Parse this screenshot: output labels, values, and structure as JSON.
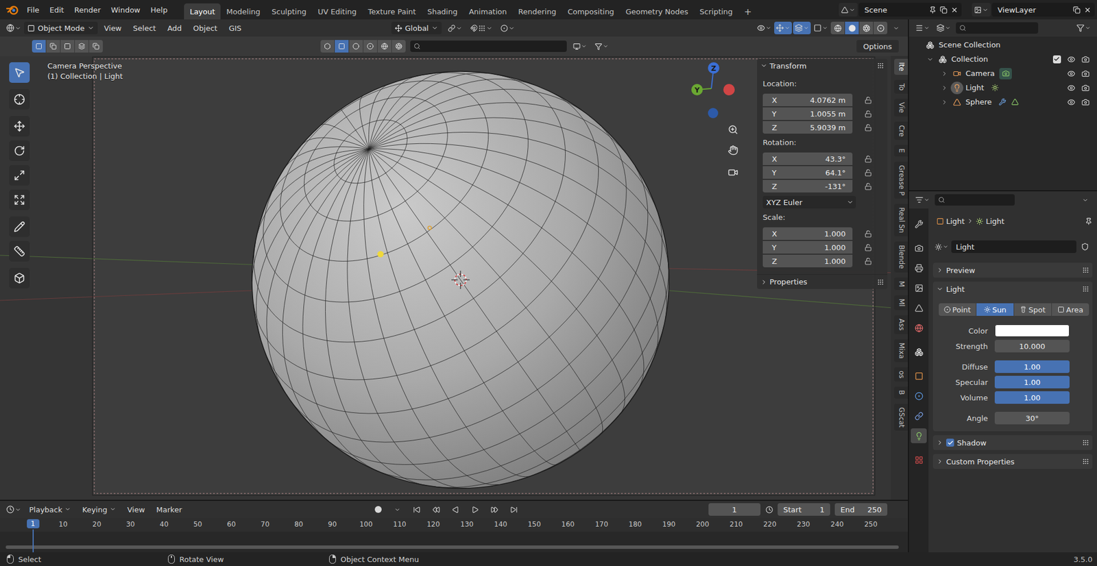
{
  "top_bar": {
    "menus": [
      "File",
      "Edit",
      "Render",
      "Window",
      "Help"
    ],
    "workspaces": [
      {
        "label": "Layout",
        "selected": true
      },
      {
        "label": "Modeling",
        "selected": false
      },
      {
        "label": "Sculpting",
        "selected": false
      },
      {
        "label": "UV Editing",
        "selected": false
      },
      {
        "label": "Texture Paint",
        "selected": false
      },
      {
        "label": "Shading",
        "selected": false
      },
      {
        "label": "Animation",
        "selected": false
      },
      {
        "label": "Rendering",
        "selected": false
      },
      {
        "label": "Compositing",
        "selected": false
      },
      {
        "label": "Geometry Nodes",
        "selected": false
      },
      {
        "label": "Scripting",
        "selected": false
      }
    ],
    "add_workspace": "+",
    "scene": "Scene",
    "view_layer": "ViewLayer"
  },
  "viewport": {
    "header": {
      "mode": "Object Mode",
      "menus": [
        "View",
        "Select",
        "Add",
        "Object",
        "GIS"
      ],
      "orientation": "Global",
      "toggles": [
        {
          "kind": "visibility",
          "on": false
        },
        {
          "kind": "gizmos",
          "on": true
        },
        {
          "kind": "overlays",
          "on": true
        },
        {
          "kind": "xray",
          "on": false
        }
      ],
      "shading": [
        {
          "kind": "wireframe",
          "selected": false
        },
        {
          "kind": "solid",
          "selected": true
        },
        {
          "kind": "material",
          "selected": false
        },
        {
          "kind": "rendered",
          "selected": false
        }
      ]
    },
    "tool_header": {
      "select_modes": [
        {
          "kind": "set",
          "selected": true
        },
        {
          "kind": "extend",
          "selected": false
        },
        {
          "kind": "subtract",
          "selected": false
        },
        {
          "kind": "invert",
          "selected": false
        },
        {
          "kind": "intersect",
          "selected": false
        }
      ],
      "view_buttons": [
        {
          "kind": "hexagon",
          "selected": false
        },
        {
          "kind": "square",
          "selected": true
        },
        {
          "kind": "circle",
          "selected": false
        },
        {
          "kind": "dot",
          "selected": false
        },
        {
          "kind": "globe",
          "selected": false
        },
        {
          "kind": "aperture",
          "selected": false
        }
      ],
      "search": "",
      "options": "Options"
    },
    "tools": [
      {
        "kind": "select",
        "selected": true
      },
      {
        "kind": "cursor",
        "selected": false
      },
      {
        "kind": "move",
        "selected": false
      },
      {
        "kind": "rotate",
        "selected": false
      },
      {
        "kind": "scale",
        "selected": false
      },
      {
        "kind": "transform",
        "selected": false
      },
      {
        "kind": "annotate",
        "selected": false
      },
      {
        "kind": "measure",
        "selected": false
      },
      {
        "kind": "add_cube",
        "selected": false
      }
    ],
    "overlay_text": [
      "Camera Perspective",
      "(1) Collection | Light"
    ],
    "gizmo_labels": [
      "Z",
      "Y"
    ],
    "sidebar": {
      "panel": {
        "title": "Transform",
        "expanded": true,
        "groups": [
          {
            "label": "Location:",
            "fields": [
              {
                "axis": "X",
                "value": "4.0762 m",
                "locked": false
              },
              {
                "axis": "Y",
                "value": "1.0055 m",
                "locked": false
              },
              {
                "axis": "Z",
                "value": "5.9039 m",
                "locked": false
              }
            ]
          },
          {
            "label": "Rotation:",
            "fields": [
              {
                "axis": "X",
                "value": "43.3°",
                "locked": false
              },
              {
                "axis": "Y",
                "value": "64.1°",
                "locked": false
              },
              {
                "axis": "Z",
                "value": "-131°",
                "locked": false
              }
            ],
            "mode": "XYZ Euler"
          },
          {
            "label": "Scale:",
            "fields": [
              {
                "axis": "X",
                "value": "1.000",
                "locked": false
              },
              {
                "axis": "Y",
                "value": "1.000",
                "locked": false
              },
              {
                "axis": "Z",
                "value": "1.000",
                "locked": false
              }
            ]
          }
        ]
      },
      "subpanel": {
        "title": "Properties",
        "expanded": false
      },
      "tabs": [
        {
          "label": "Ite",
          "selected": true
        },
        {
          "label": "To",
          "selected": false
        },
        {
          "label": "Vie",
          "selected": false
        },
        {
          "label": "Cre",
          "selected": false
        },
        {
          "label": "E",
          "selected": false
        },
        {
          "label": "Grease P",
          "selected": false
        },
        {
          "label": "Real Sn",
          "selected": false
        },
        {
          "label": "Blende",
          "selected": false
        },
        {
          "label": "M",
          "selected": false
        },
        {
          "label": "Ml",
          "selected": false
        },
        {
          "label": "Ass",
          "selected": false
        },
        {
          "label": "Mixa",
          "selected": false
        },
        {
          "label": "os",
          "selected": false
        },
        {
          "label": "B",
          "selected": false
        },
        {
          "label": "GScat",
          "selected": false
        }
      ]
    }
  },
  "outliner": {
    "search": "",
    "tree": {
      "name": "Scene Collection",
      "kind": "scene_collection",
      "children": [
        {
          "name": "Collection",
          "kind": "collection",
          "expanded": true,
          "included": true,
          "visible": true,
          "renderable": true,
          "children": [
            {
              "name": "Camera",
              "kind": "camera",
              "expanded": false,
              "active": false,
              "visible": true,
              "renderable": true,
              "data": [
                {
                  "kind": "camera_data",
                  "highlighted": true
                }
              ]
            },
            {
              "name": "Light",
              "kind": "light",
              "expanded": false,
              "active": true,
              "visible": true,
              "renderable": true,
              "data": [
                {
                  "kind": "light_data",
                  "highlighted": false
                }
              ]
            },
            {
              "name": "Sphere",
              "kind": "mesh",
              "expanded": false,
              "active": false,
              "visible": true,
              "renderable": true,
              "data": [
                {
                  "kind": "modifier",
                  "highlighted": false
                },
                {
                  "kind": "mesh_data",
                  "highlighted": false
                }
              ]
            }
          ]
        }
      ]
    }
  },
  "properties": {
    "search": "",
    "tabs": [
      {
        "kind": "tool",
        "selected": false
      },
      {
        "kind": "render",
        "selected": false
      },
      {
        "kind": "output",
        "selected": false
      },
      {
        "kind": "view_layer",
        "selected": false
      },
      {
        "kind": "scene",
        "selected": false
      },
      {
        "kind": "world",
        "selected": false
      },
      {
        "kind": "collection",
        "selected": false
      },
      {
        "kind": "object",
        "selected": false
      },
      {
        "kind": "physics",
        "selected": false
      },
      {
        "kind": "constraints",
        "selected": false
      },
      {
        "kind": "data",
        "selected": true
      },
      {
        "kind": "texture",
        "selected": false
      }
    ],
    "breadcrumb": [
      "Light",
      "Light"
    ],
    "datablock": "Light",
    "preview": {
      "title": "Preview",
      "expanded": false
    },
    "light": {
      "title": "Light",
      "expanded": true,
      "types": [
        {
          "label": "Point",
          "selected": false
        },
        {
          "label": "Sun",
          "selected": true
        },
        {
          "label": "Spot",
          "selected": false
        },
        {
          "label": "Area",
          "selected": false
        }
      ],
      "fields": [
        {
          "label": "Color",
          "kind": "color",
          "swatch": "#ffffff"
        },
        {
          "label": "Strength",
          "kind": "number",
          "value": "10.000"
        },
        {
          "label": "Diffuse",
          "kind": "slider",
          "value": "1.00",
          "level": 1
        },
        {
          "label": "Specular",
          "kind": "slider",
          "value": "1.00",
          "level": 1
        },
        {
          "label": "Volume",
          "kind": "slider",
          "value": "1.00",
          "level": 1
        },
        {
          "label": "Angle",
          "kind": "number",
          "value": "30°"
        }
      ]
    },
    "shadow": {
      "title": "Shadow",
      "checked": true,
      "expanded": false
    },
    "custom": {
      "title": "Custom Properties",
      "expanded": false
    }
  },
  "timeline": {
    "menus": [
      {
        "label": "Playback",
        "dropdown": true
      },
      {
        "label": "Keying",
        "dropdown": true
      },
      {
        "label": "View",
        "dropdown": false
      },
      {
        "label": "Marker",
        "dropdown": false
      }
    ],
    "auto_key": false,
    "frame": "1",
    "start": {
      "label": "Start",
      "value": "1"
    },
    "end": {
      "label": "End",
      "value": "250"
    },
    "current_frame": "1",
    "ruler": [
      "10",
      "20",
      "30",
      "40",
      "50",
      "60",
      "70",
      "80",
      "90",
      "100",
      "110",
      "120",
      "130",
      "140",
      "150",
      "160",
      "170",
      "180",
      "190",
      "200",
      "210",
      "220",
      "230",
      "240",
      "250"
    ]
  },
  "status_bar": {
    "items": [
      {
        "kind": "left",
        "label": "Select"
      },
      {
        "kind": "middle",
        "label": "Rotate View"
      },
      {
        "kind": "right",
        "label": "Object Context Menu"
      }
    ],
    "version": "3.5.0"
  }
}
